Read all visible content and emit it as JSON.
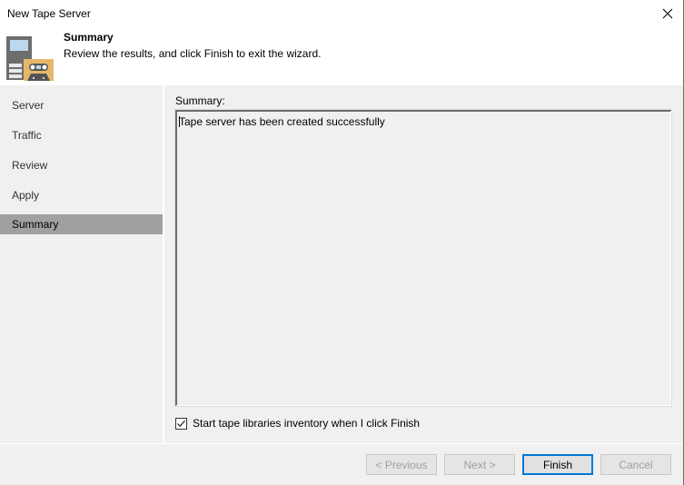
{
  "window": {
    "title": "New Tape Server"
  },
  "header": {
    "title": "Summary",
    "subtitle": "Review the results, and click Finish to exit the wizard.",
    "icon": "tape-server-icon"
  },
  "sidebar": {
    "items": [
      {
        "label": "Server",
        "active": false
      },
      {
        "label": "Traffic",
        "active": false
      },
      {
        "label": "Review",
        "active": false
      },
      {
        "label": "Apply",
        "active": false
      },
      {
        "label": "Summary",
        "active": true
      }
    ]
  },
  "content": {
    "summary_label": "Summary:",
    "summary_text": "Tape server has been created successfully",
    "checkbox": {
      "label": "Start tape libraries inventory when I click Finish",
      "checked": true
    }
  },
  "footer": {
    "previous_label": "< Previous",
    "next_label": "Next >",
    "finish_label": "Finish",
    "cancel_label": "Cancel"
  },
  "colors": {
    "accent": "#0078d7",
    "active_step": "#a0a0a0",
    "background": "#f0f0f0"
  }
}
